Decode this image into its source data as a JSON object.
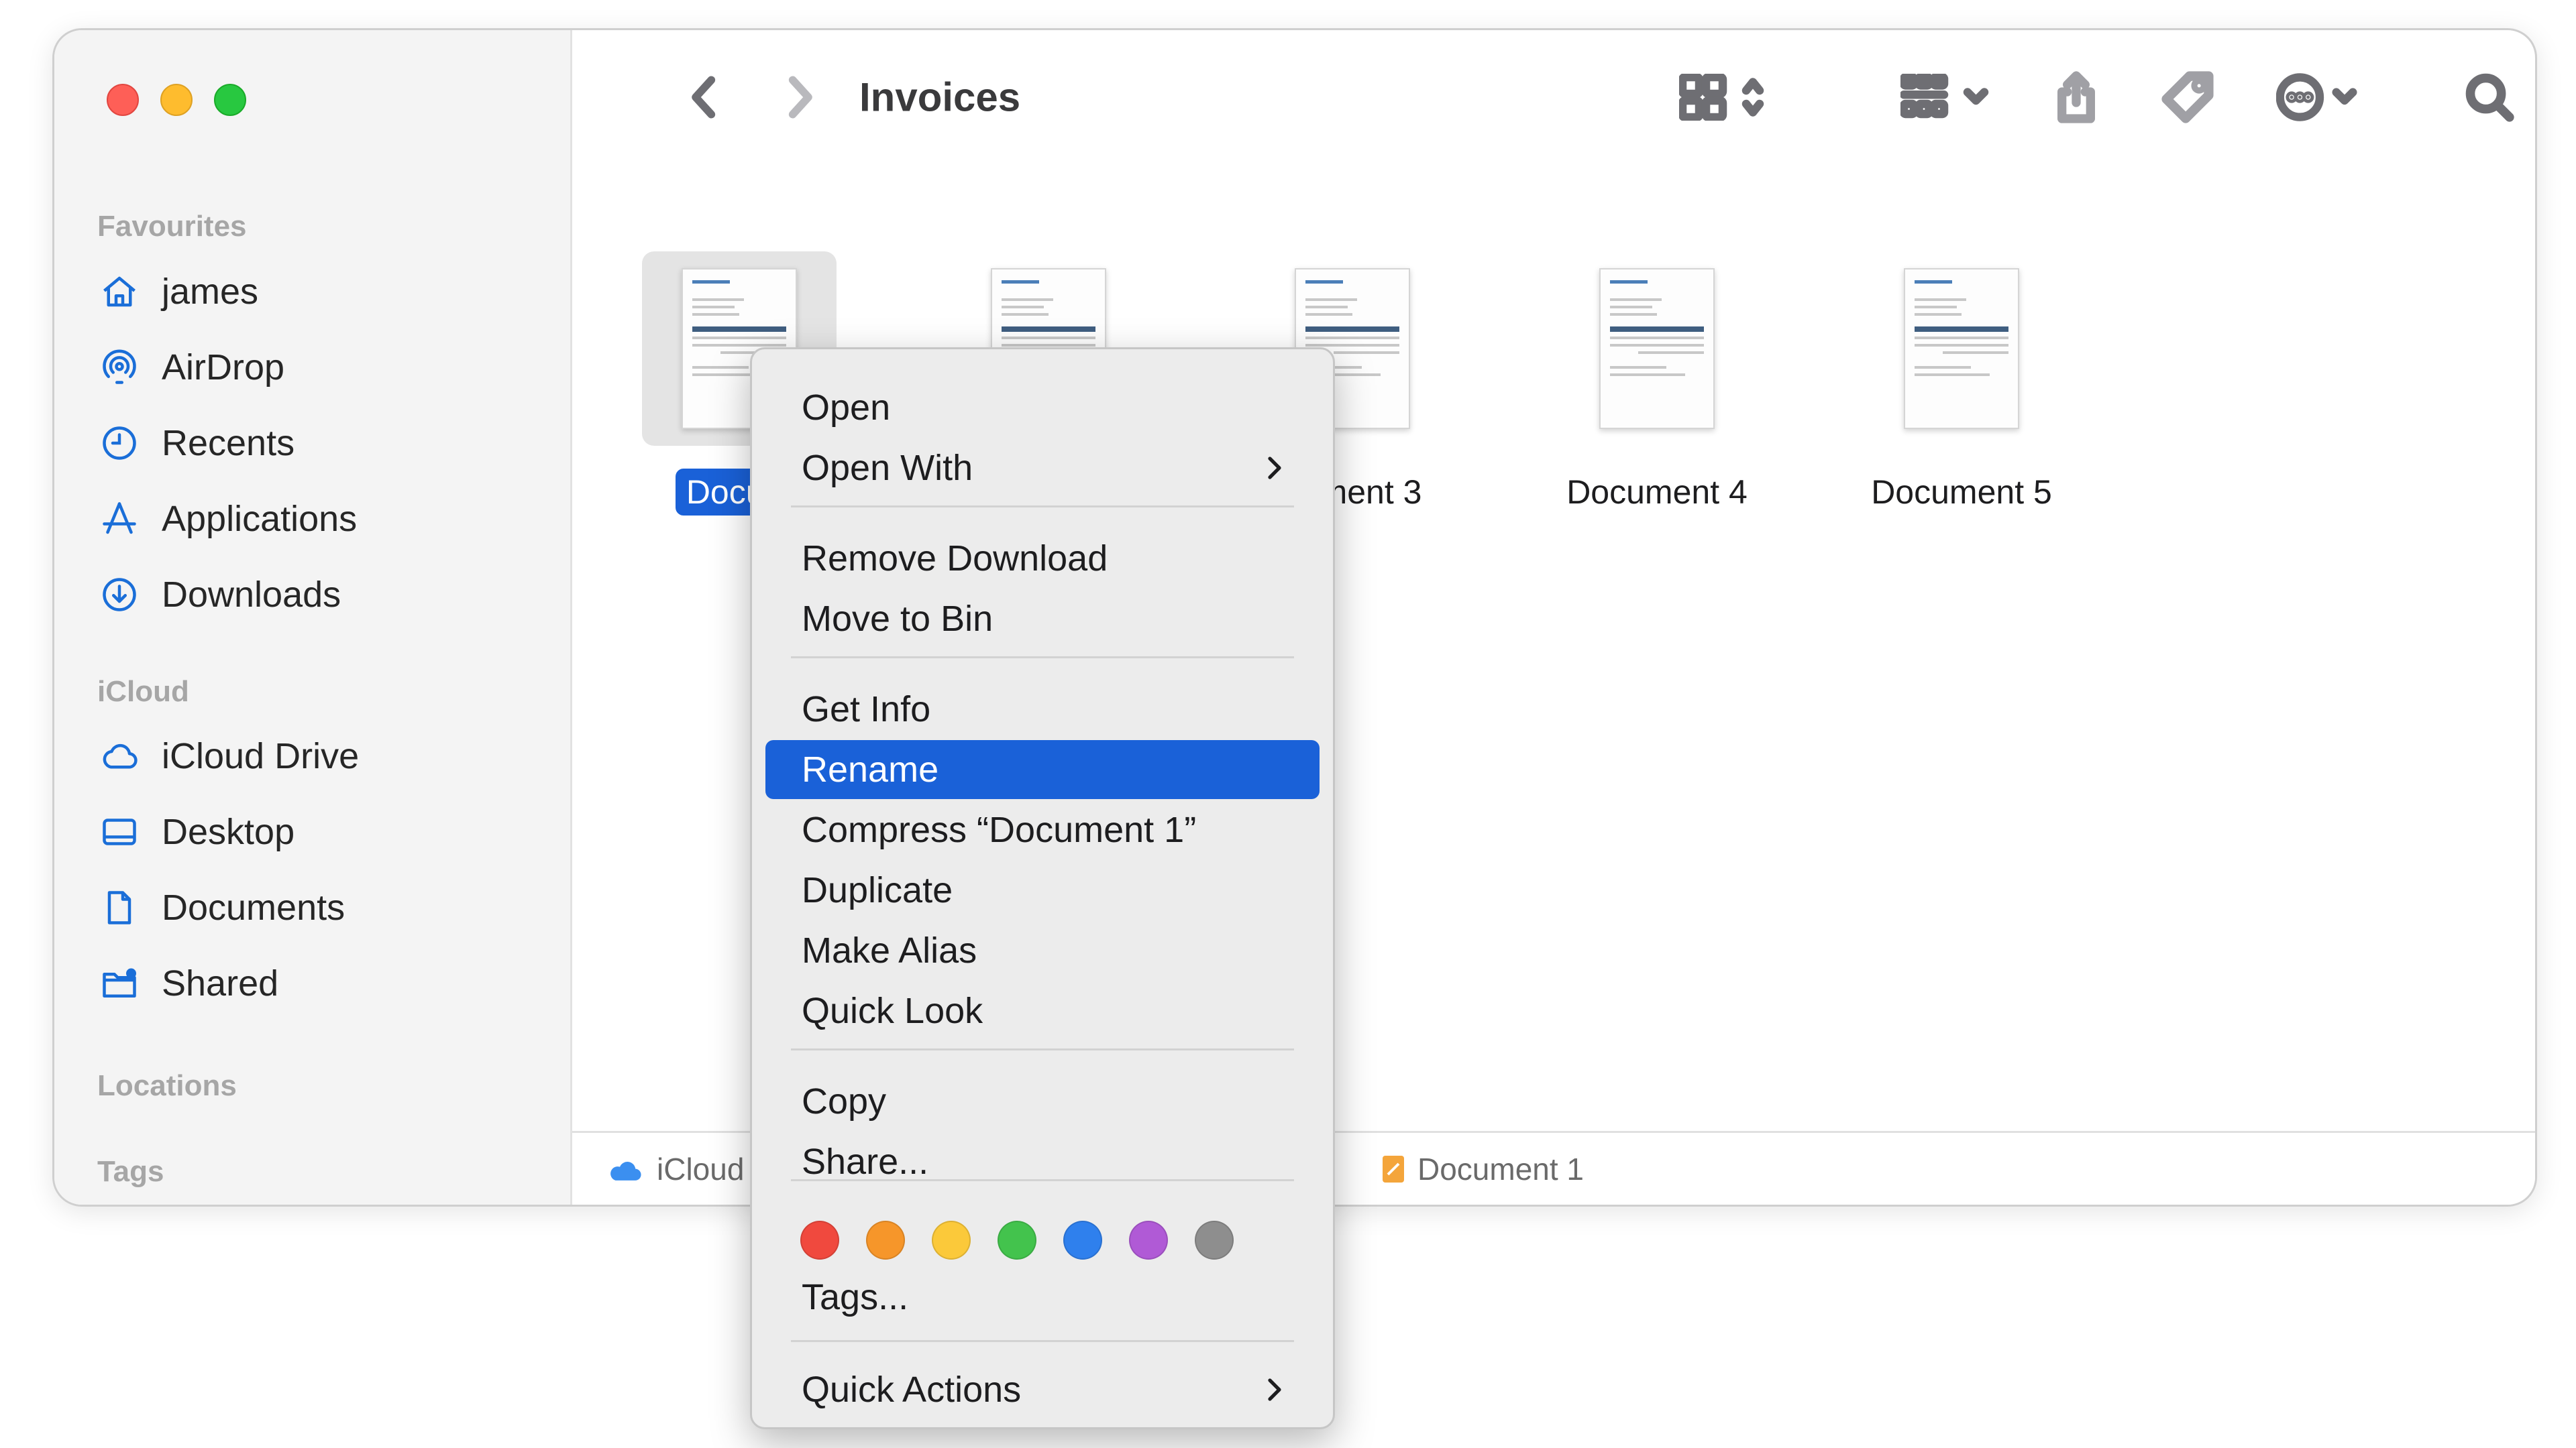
{
  "window": {
    "title": "Invoices"
  },
  "sidebar": {
    "sections": [
      {
        "label": "Favourites"
      },
      {
        "label": "iCloud"
      },
      {
        "label": "Locations"
      },
      {
        "label": "Tags"
      }
    ],
    "items": [
      {
        "label": "james",
        "icon": "home-icon"
      },
      {
        "label": "AirDrop",
        "icon": "airdrop-icon"
      },
      {
        "label": "Recents",
        "icon": "clock-icon"
      },
      {
        "label": "Applications",
        "icon": "applications-icon"
      },
      {
        "label": "Downloads",
        "icon": "download-icon"
      },
      {
        "label": "iCloud Drive",
        "icon": "cloud-icon"
      },
      {
        "label": "Desktop",
        "icon": "desktop-icon"
      },
      {
        "label": "Documents",
        "icon": "document-icon"
      },
      {
        "label": "Shared",
        "icon": "shared-folder-icon"
      }
    ],
    "accent": "#1a6ed8"
  },
  "files": [
    {
      "label": "Docum",
      "selected": true
    },
    {
      "label": ""
    },
    {
      "label": "ment 3"
    },
    {
      "label": "Document 4"
    },
    {
      "label": "Document 5"
    }
  ],
  "pathbar": {
    "root": "iCloud",
    "current": "Document 1"
  },
  "context_menu": {
    "items": [
      {
        "label": "Open"
      },
      {
        "label": "Open With",
        "submenu": true
      },
      {
        "label": "Remove Download"
      },
      {
        "label": "Move to Bin"
      },
      {
        "label": "Get Info"
      },
      {
        "label": "Rename",
        "highlighted": true
      },
      {
        "label": "Compress “Document 1”"
      },
      {
        "label": "Duplicate"
      },
      {
        "label": "Make Alias"
      },
      {
        "label": "Quick Look"
      },
      {
        "label": "Copy"
      },
      {
        "label": "Share..."
      },
      {
        "label": "Tags..."
      },
      {
        "label": "Quick Actions",
        "submenu": true
      }
    ],
    "tag_colors": [
      "#f0493e",
      "#f6962a",
      "#fbc93a",
      "#43c34d",
      "#2f80ed",
      "#b05ad6",
      "#8e8e8e"
    ],
    "highlight_color": "#1a61d8"
  }
}
